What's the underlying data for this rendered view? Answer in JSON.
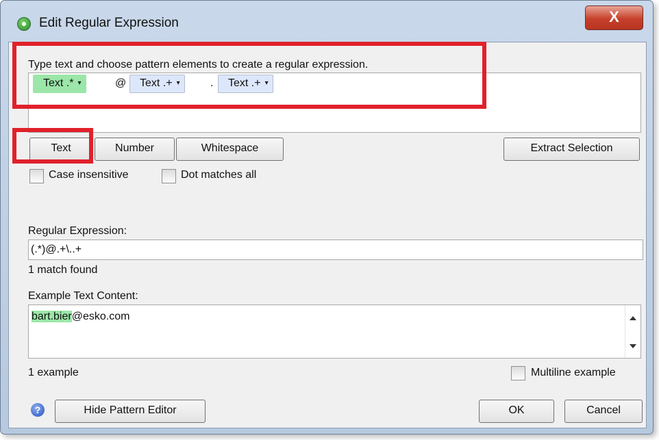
{
  "window": {
    "title": "Edit Regular Expression",
    "close_glyph": "X"
  },
  "pattern_editor": {
    "instructions": "Type text and choose pattern elements to create a regular expression.",
    "chips": [
      {
        "label": "Text .*",
        "style": "highlighted"
      },
      {
        "label": "Text .+",
        "style": "normal"
      },
      {
        "label": "Text .+",
        "style": "normal"
      }
    ],
    "separators": [
      "@",
      "."
    ],
    "caret": "▾"
  },
  "element_buttons": [
    "Text",
    "Number",
    "Whitespace"
  ],
  "extract_button": "Extract Selection",
  "options": {
    "case_insensitive": {
      "label": "Case insensitive",
      "checked": false
    },
    "dot_matches_all": {
      "label": "Dot matches all",
      "checked": false
    }
  },
  "regex": {
    "label": "Regular Expression:",
    "value": "(.*)@.+\\..+",
    "status": "1 match found"
  },
  "example": {
    "label": "Example Text Content:",
    "matched": "bart.bier",
    "rest": "@esko.com",
    "count": "1 example",
    "multiline": {
      "label": "Multiline example",
      "checked": false
    }
  },
  "footer": {
    "hide_button": "Hide Pattern Editor",
    "ok": "OK",
    "cancel": "Cancel",
    "help_glyph": "?"
  },
  "colors": {
    "highlight": "#9be6a8",
    "chip_blue": "#dde7fb",
    "annotation_red": "#e0212b"
  }
}
